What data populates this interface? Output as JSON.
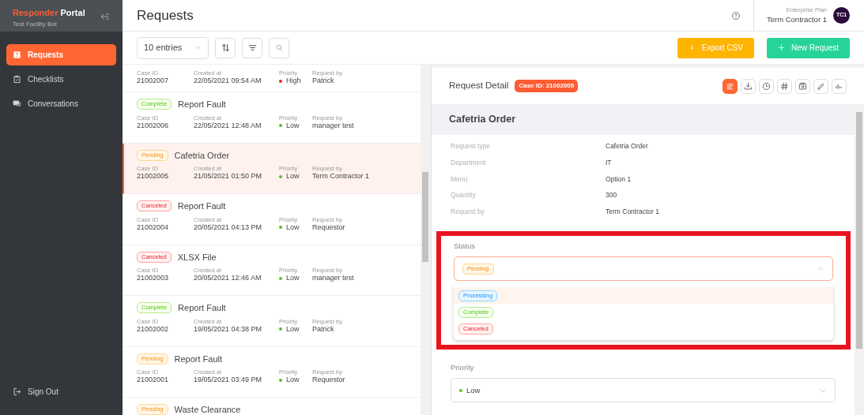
{
  "sidebar": {
    "brand_first": "Responder",
    "brand_second": "Portal",
    "subtitle": "Test Facility Bot",
    "items": [
      {
        "label": "Requests",
        "selected": true
      },
      {
        "label": "Checklists",
        "selected": false
      },
      {
        "label": "Conversations",
        "selected": false
      }
    ],
    "sign_out": "Sign Out"
  },
  "header": {
    "title": "Requests",
    "plan": "Enterprise Plan",
    "user": "Term Contractor 1",
    "avatar": "TC1"
  },
  "toolbar": {
    "entries": "10 entries",
    "export": "Export CSV",
    "new_request": "New Request"
  },
  "requests": [
    {
      "selected": false,
      "fields": [
        {
          "label": "Case ID",
          "value": "21002007"
        },
        {
          "label": "Created at",
          "value": "22/05/2021 09:54 AM"
        },
        {
          "label": "Priority",
          "value": "High",
          "color": "#f5222d"
        },
        {
          "label": "Request by",
          "value": "Patrick"
        }
      ]
    },
    {
      "status": {
        "text": "Complete",
        "kind": "complete"
      },
      "title": "Report Fault",
      "selected": false,
      "fields": [
        {
          "label": "Case ID",
          "value": "21002006"
        },
        {
          "label": "Created at",
          "value": "22/05/2021 12:48 AM"
        },
        {
          "label": "Priority",
          "value": "Low",
          "color": "#52c41a"
        },
        {
          "label": "Request by",
          "value": "manager test"
        }
      ]
    },
    {
      "status": {
        "text": "Pending",
        "kind": "pending"
      },
      "title": "Cafetria Order",
      "selected": true,
      "fields": [
        {
          "label": "Case ID",
          "value": "21002005"
        },
        {
          "label": "Created at",
          "value": "21/05/2021 01:50 PM"
        },
        {
          "label": "Priority",
          "value": "Low",
          "color": "#52c41a"
        },
        {
          "label": "Request by",
          "value": "Term Contractor 1"
        }
      ]
    },
    {
      "status": {
        "text": "Canceled",
        "kind": "canceled"
      },
      "title": "Report Fault",
      "selected": false,
      "fields": [
        {
          "label": "Case ID",
          "value": "21002004"
        },
        {
          "label": "Created at",
          "value": "20/05/2021 04:13 PM"
        },
        {
          "label": "Priority",
          "value": "Low",
          "color": "#52c41a"
        },
        {
          "label": "Request by",
          "value": "Requestor"
        }
      ]
    },
    {
      "status": {
        "text": "Canceled",
        "kind": "canceled"
      },
      "title": "XLSX File",
      "selected": false,
      "fields": [
        {
          "label": "Case ID",
          "value": "21002003"
        },
        {
          "label": "Created at",
          "value": "20/05/2021 12:46 AM"
        },
        {
          "label": "Priority",
          "value": "Low",
          "color": "#52c41a"
        },
        {
          "label": "Request by",
          "value": "manager test"
        }
      ]
    },
    {
      "status": {
        "text": "Complete",
        "kind": "complete"
      },
      "title": "Report Fault",
      "selected": false,
      "fields": [
        {
          "label": "Case ID",
          "value": "21002002"
        },
        {
          "label": "Created at",
          "value": "19/05/2021 04:38 PM"
        },
        {
          "label": "Priority",
          "value": "Low",
          "color": "#52c41a"
        },
        {
          "label": "Request by",
          "value": "Patrick"
        }
      ]
    },
    {
      "status": {
        "text": "Pending",
        "kind": "pending"
      },
      "title": "Report Fault",
      "selected": false,
      "fields": [
        {
          "label": "Case ID",
          "value": "21002001"
        },
        {
          "label": "Created at",
          "value": "19/05/2021 03:49 PM"
        },
        {
          "label": "Priority",
          "value": "Low",
          "color": "#52c41a"
        },
        {
          "label": "Request by",
          "value": "Requestor"
        }
      ]
    },
    {
      "status": {
        "text": "Pending",
        "kind": "pending"
      },
      "title": "Waste Clearance",
      "selected": false
    }
  ],
  "detail": {
    "heading": "Request Detail",
    "case_badge": "Case ID: 21002005",
    "title": "Cafetria Order",
    "actions": [
      {
        "selected": true
      },
      {
        "selected": false
      },
      {
        "selected": false
      },
      {
        "selected": false
      },
      {
        "selected": false
      },
      {
        "selected": false
      },
      {
        "selected": false
      }
    ],
    "fields": [
      {
        "label": "Request type",
        "value": "Cafetria Order"
      },
      {
        "label": "Department",
        "value": "IT"
      },
      {
        "label": "Menu",
        "value": "Option 1"
      },
      {
        "label": "Quantity",
        "value": "300"
      },
      {
        "label": "Request by",
        "value": "Term Contractor 1"
      }
    ],
    "status": {
      "label": "Status",
      "highlighted": true,
      "expanded": true,
      "value": {
        "text": "Pending",
        "kind": "pending"
      },
      "options": [
        {
          "label": "Processing",
          "kind": "processing",
          "selected": true
        },
        {
          "label": "Complete",
          "kind": "complete",
          "selected": false
        },
        {
          "label": "Canceled",
          "kind": "canceled",
          "selected": false
        }
      ]
    },
    "priority": {
      "label": "Priority",
      "value": "Low",
      "color": "#52c41a"
    }
  }
}
